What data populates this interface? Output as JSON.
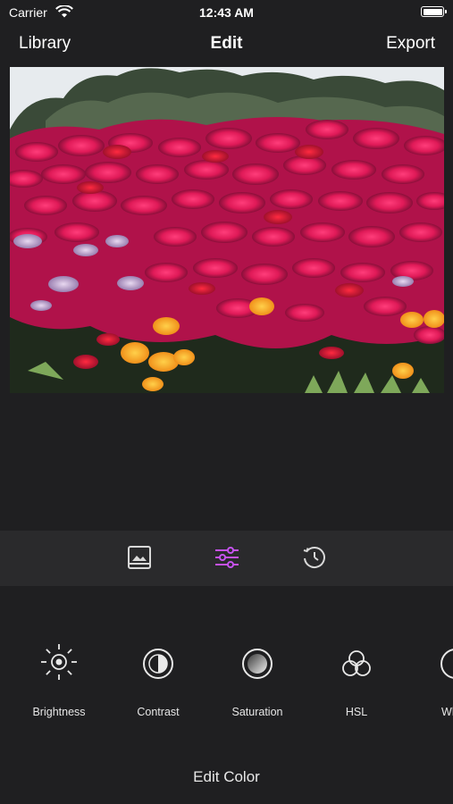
{
  "status_bar": {
    "carrier": "Carrier",
    "time": "12:43 AM"
  },
  "nav": {
    "left": "Library",
    "title": "Edit",
    "right": "Export"
  },
  "toolbar": {
    "tabs": [
      {
        "icon": "photo-icon",
        "selected": false
      },
      {
        "icon": "sliders-icon",
        "selected": true
      },
      {
        "icon": "history-icon",
        "selected": false
      }
    ],
    "accent": "#c652f0"
  },
  "adjustments": [
    {
      "label": "Brightness",
      "icon": "sun-icon"
    },
    {
      "label": "Contrast",
      "icon": "contrast-icon"
    },
    {
      "label": "Saturation",
      "icon": "saturation-icon"
    },
    {
      "label": "HSL",
      "icon": "hsl-icon"
    },
    {
      "label": "White",
      "icon": "white-balance-icon"
    }
  ],
  "footer": {
    "label": "Edit Color"
  }
}
